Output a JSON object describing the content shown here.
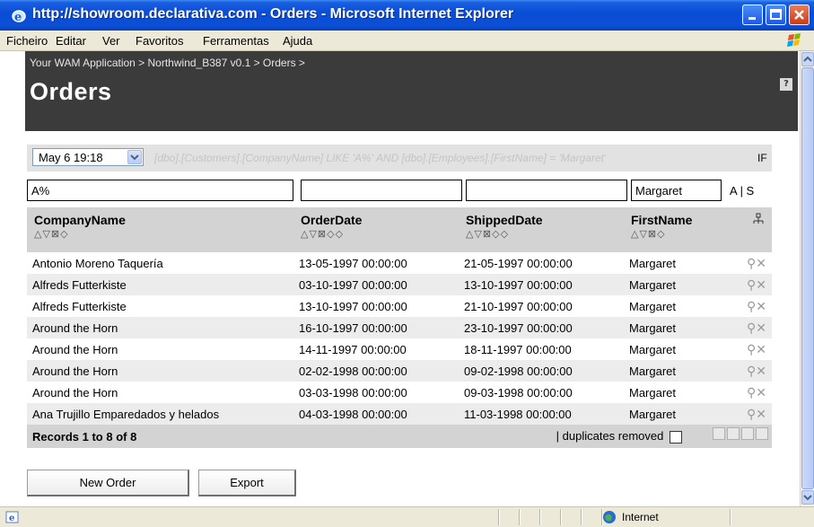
{
  "window": {
    "title": "http://showroom.declarativa.com - Orders - Microsoft Internet Explorer"
  },
  "menu": {
    "items": [
      "Ficheiro",
      "Editar",
      "Ver",
      "Favoritos",
      "Ferramentas",
      "Ajuda"
    ]
  },
  "app": {
    "breadcrumb": "Your WAM Application > Northwind_B387 v0.1 > Orders >",
    "page_title": "Orders",
    "help_label": "?"
  },
  "filter": {
    "snapshot_value": "May 6 19:18",
    "where_clause": "[dbo].[Customers].[CompanyName] LIKE 'A%' AND [dbo].[Employees].[FirstName] = 'Margaret'",
    "if_label": "IF",
    "inputs": {
      "company": "A%",
      "orderdate": "",
      "shippeddate": "",
      "firstname": "Margaret"
    },
    "as_toggle": "A | S"
  },
  "grid": {
    "columns": [
      {
        "label": "CompanyName",
        "sort_icons": "△▽⊠◇"
      },
      {
        "label": "OrderDate",
        "sort_icons": "△▽⊠◇◇"
      },
      {
        "label": "ShippedDate",
        "sort_icons": "△▽⊠◇◇"
      },
      {
        "label": "FirstName",
        "sort_icons": "△▽⊠◇"
      }
    ],
    "rows": [
      {
        "company": "Antonio Moreno Taquería",
        "order": "13-05-1997 00:00:00",
        "shipped": "21-05-1997 00:00:00",
        "first": "Margaret"
      },
      {
        "company": "Alfreds Futterkiste",
        "order": "03-10-1997 00:00:00",
        "shipped": "13-10-1997 00:00:00",
        "first": "Margaret"
      },
      {
        "company": "Alfreds Futterkiste",
        "order": "13-10-1997 00:00:00",
        "shipped": "21-10-1997 00:00:00",
        "first": "Margaret"
      },
      {
        "company": "Around the Horn",
        "order": "16-10-1997 00:00:00",
        "shipped": "23-10-1997 00:00:00",
        "first": "Margaret"
      },
      {
        "company": "Around the Horn",
        "order": "14-11-1997 00:00:00",
        "shipped": "18-11-1997 00:00:00",
        "first": "Margaret"
      },
      {
        "company": "Around the Horn",
        "order": "02-02-1998 00:00:00",
        "shipped": "09-02-1998 00:00:00",
        "first": "Margaret"
      },
      {
        "company": "Around the Horn",
        "order": "03-03-1998 00:00:00",
        "shipped": "09-03-1998 00:00:00",
        "first": "Margaret"
      },
      {
        "company": "Ana Trujillo Emparedados y helados",
        "order": "04-03-1998 00:00:00",
        "shipped": "11-03-1998 00:00:00",
        "first": "Margaret"
      }
    ],
    "records_label": "Records 1 to 8 of 8",
    "duplicates_label": "| duplicates removed"
  },
  "buttons": {
    "new_order": "New Order",
    "export": "Export"
  },
  "status": {
    "zone": "Internet"
  },
  "colors": {
    "title_bar": "#0a4ed6",
    "header_band": "#3b3b3b",
    "grid_header": "#d3d3d3",
    "row_alt": "#ececec"
  }
}
